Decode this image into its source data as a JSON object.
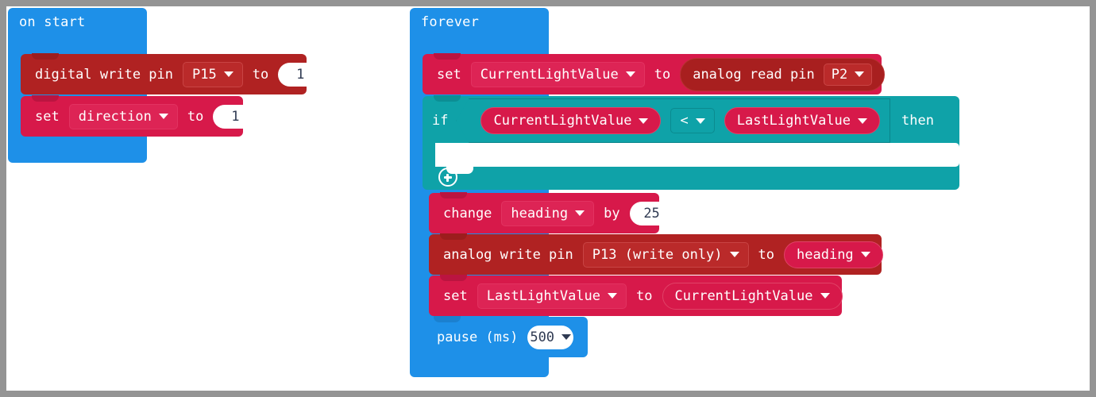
{
  "canvas": {
    "background": "#ffffff",
    "frame_color": "#949494"
  },
  "palette": {
    "event_blue": "#1E90E8",
    "pins_dark_red": "#B02222",
    "variables_crimson": "#D7194A",
    "logic_teal": "#0FA2A8",
    "input_white": "#ffffff",
    "number_text": "#2f3a52"
  },
  "scripts": [
    {
      "id": "on-start-script",
      "hat_label": "on start",
      "color": "#1E90E8",
      "blocks": [
        {
          "id": "digital-write-pin",
          "color": "#B02222",
          "parts": [
            {
              "type": "text",
              "value": "digital write pin"
            },
            {
              "type": "dropdown",
              "value": "P15"
            },
            {
              "type": "text",
              "value": "to"
            },
            {
              "type": "number",
              "value": "1"
            }
          ]
        },
        {
          "id": "set-direction",
          "color": "#D7194A",
          "parts": [
            {
              "type": "text",
              "value": "set"
            },
            {
              "type": "dropdown",
              "value": "direction"
            },
            {
              "type": "text",
              "value": "to"
            },
            {
              "type": "number",
              "value": "1"
            }
          ]
        }
      ]
    },
    {
      "id": "forever-script",
      "hat_label": "forever",
      "color": "#1E90E8",
      "blocks": [
        {
          "id": "set-currentlightvalue",
          "color": "#D7194A",
          "parts": [
            {
              "type": "text",
              "value": "set"
            },
            {
              "type": "dropdown",
              "value": "CurrentLightValue"
            },
            {
              "type": "text",
              "value": "to"
            },
            {
              "type": "reporter",
              "value": "analog read pin",
              "field": "P2"
            }
          ]
        },
        {
          "id": "if-then",
          "color": "#0FA2A8",
          "keyword": "if",
          "then_label": "then",
          "condition": {
            "left": "CurrentLightValue",
            "operator": "<",
            "right": "LastLightValue"
          },
          "body_empty": true,
          "footer_icon": "plus-icon"
        },
        {
          "id": "change-heading",
          "color": "#D7194A",
          "parts": [
            {
              "type": "text",
              "value": "change"
            },
            {
              "type": "dropdown",
              "value": "heading"
            },
            {
              "type": "text",
              "value": "by"
            },
            {
              "type": "number",
              "value": "25"
            }
          ]
        },
        {
          "id": "analog-write-pin",
          "color": "#B02222",
          "parts": [
            {
              "type": "text",
              "value": "analog write pin"
            },
            {
              "type": "dropdown",
              "value": "P13 (write only)"
            },
            {
              "type": "text",
              "value": "to"
            },
            {
              "type": "reporter",
              "value": "heading"
            }
          ]
        },
        {
          "id": "set-lastlightvalue",
          "color": "#D7194A",
          "parts": [
            {
              "type": "text",
              "value": "set"
            },
            {
              "type": "dropdown",
              "value": "LastLightValue"
            },
            {
              "type": "text",
              "value": "to"
            },
            {
              "type": "reporter",
              "value": "CurrentLightValue"
            }
          ]
        },
        {
          "id": "pause-ms",
          "color": "#1E90E8",
          "parts": [
            {
              "type": "text",
              "value": "pause (ms)"
            },
            {
              "type": "number_dropdown",
              "value": "500"
            }
          ]
        }
      ]
    }
  ],
  "labels": {
    "on_start": "on start",
    "forever": "forever",
    "digital_write_pin": "digital write pin",
    "p15": "P15",
    "to": "to",
    "one_a": "1",
    "set_a": "set",
    "direction": "direction",
    "one_b": "1",
    "set_b": "set",
    "current_light_value_a": "CurrentLightValue",
    "to_b": "to",
    "analog_read_pin": "analog read pin",
    "p2": "P2",
    "if": "if",
    "current_light_value_b": "CurrentLightValue",
    "less_than": "<",
    "last_light_value_a": "LastLightValue",
    "then": "then",
    "change": "change",
    "heading_a": "heading",
    "by": "by",
    "twenty_five": "25",
    "analog_write_pin": "analog write pin",
    "p13": "P13 (write only)",
    "to_c": "to",
    "heading_b": "heading",
    "set_c": "set",
    "last_light_value_b": "LastLightValue",
    "to_d": "to",
    "current_light_value_c": "CurrentLightValue",
    "pause_ms": "pause (ms)",
    "five_hundred": "500"
  }
}
